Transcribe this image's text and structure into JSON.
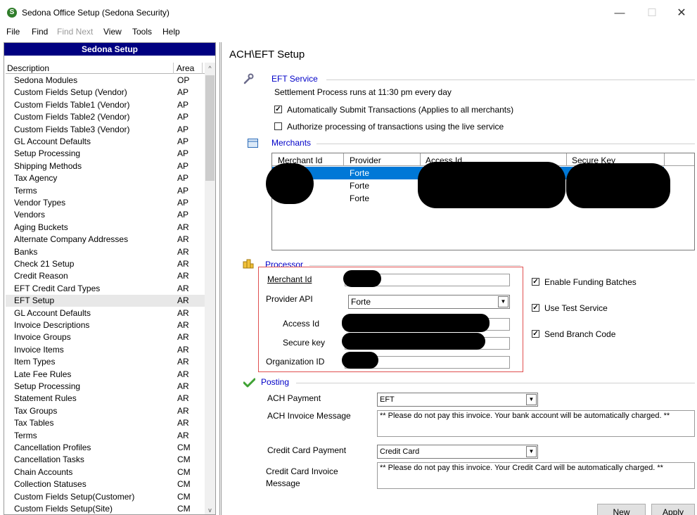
{
  "window": {
    "title": "Sedona Office Setup (Sedona Security)",
    "app_icon_letter": "S",
    "minimize_glyph": "—",
    "maximize_glyph": "☐",
    "close_glyph": "✕"
  },
  "menu": [
    {
      "label": "File",
      "enabled": true
    },
    {
      "label": "Find",
      "enabled": true
    },
    {
      "label": "Find Next",
      "enabled": false
    },
    {
      "label": "View",
      "enabled": true
    },
    {
      "label": "Tools",
      "enabled": true
    },
    {
      "label": "Help",
      "enabled": true
    }
  ],
  "left_panel": {
    "header": "Sedona Setup",
    "columns": {
      "description": "Description",
      "area": "Area"
    },
    "scroll_up": "^",
    "scroll_down": "v",
    "selected_index": 21,
    "items": [
      {
        "description": "Sedona Modules",
        "area": "OP"
      },
      {
        "description": "Custom Fields Setup (Vendor)",
        "area": "AP"
      },
      {
        "description": "Custom Fields Table1 (Vendor)",
        "area": "AP"
      },
      {
        "description": "Custom Fields Table2 (Vendor)",
        "area": "AP"
      },
      {
        "description": "Custom Fields Table3 (Vendor)",
        "area": "AP"
      },
      {
        "description": "GL Account Defaults",
        "area": "AP"
      },
      {
        "description": "Setup Processing",
        "area": "AP"
      },
      {
        "description": "Shipping Methods",
        "area": "AP"
      },
      {
        "description": "Tax Agency",
        "area": "AP"
      },
      {
        "description": "Terms",
        "area": "AP"
      },
      {
        "description": "Vendor Types",
        "area": "AP"
      },
      {
        "description": "Vendors",
        "area": "AP"
      },
      {
        "description": "Aging Buckets",
        "area": "AR"
      },
      {
        "description": "Alternate Company Addresses",
        "area": "AR"
      },
      {
        "description": "Banks",
        "area": "AR"
      },
      {
        "description": "Check 21 Setup",
        "area": "AR"
      },
      {
        "description": "Credit Reason",
        "area": "AR"
      },
      {
        "description": "EFT Credit Card Types",
        "area": "AR"
      },
      {
        "description": "EFT Setup",
        "area": "AR"
      },
      {
        "description": "GL Account Defaults",
        "area": "AR"
      },
      {
        "description": "Invoice Descriptions",
        "area": "AR"
      },
      {
        "description": "Invoice Groups",
        "area": "AR"
      },
      {
        "description": "Invoice Items",
        "area": "AR"
      },
      {
        "description": "Item Types",
        "area": "AR"
      },
      {
        "description": "Late Fee Rules",
        "area": "AR"
      },
      {
        "description": "Setup Processing",
        "area": "AR"
      },
      {
        "description": "Statement Rules",
        "area": "AR"
      },
      {
        "description": "Tax Groups",
        "area": "AR"
      },
      {
        "description": "Tax Tables",
        "area": "AR"
      },
      {
        "description": "Terms",
        "area": "AR"
      },
      {
        "description": "Cancellation Profiles",
        "area": "CM"
      },
      {
        "description": "Cancellation Tasks",
        "area": "CM"
      },
      {
        "description": "Chain Accounts",
        "area": "CM"
      },
      {
        "description": "Collection Statuses",
        "area": "CM"
      },
      {
        "description": "Custom Fields Setup(Customer)",
        "area": "CM"
      },
      {
        "description": "Custom Fields Setup(Site)",
        "area": "CM"
      }
    ]
  },
  "page": {
    "title": "ACH\\EFT Setup",
    "eft_service": {
      "label": "EFT Service",
      "settlement_text": "Settlement Process runs at 11:30 pm every day",
      "auto_submit": {
        "label": "Automatically Submit Transactions (Applies to all merchants)",
        "checked": true
      },
      "live_service": {
        "label": "Authorize processing of transactions using the live service",
        "checked": false
      }
    },
    "merchants": {
      "label": "Merchants",
      "columns": [
        "Merchant Id",
        "Provider",
        "Access Id",
        "Secure Key"
      ],
      "rows": [
        {
          "provider": "Forte",
          "selected": true,
          "secure_key_suffix": ""
        },
        {
          "provider": "Forte",
          "selected": false,
          "secure_key_suffix": ""
        },
        {
          "provider": "Forte",
          "selected": false,
          "secure_key_suffix": ".."
        }
      ]
    },
    "processor": {
      "label": "Processor",
      "merchant_id_label": "Merchant Id",
      "provider_api_label": "Provider API",
      "provider_api_value": "Forte",
      "access_id_label": "Access Id",
      "secure_key_label": "Secure key",
      "organization_id_label": "Organization ID",
      "enable_funding": {
        "label": "Enable Funding Batches",
        "checked": true
      },
      "use_test": {
        "label": "Use Test Service",
        "checked": true
      },
      "send_branch": {
        "label": "Send Branch Code",
        "checked": true
      }
    },
    "posting": {
      "label": "Posting",
      "ach_payment_label": "ACH Payment",
      "ach_payment_value": "EFT",
      "ach_invoice_label": "ACH Invoice Message",
      "ach_invoice_value": "** Please do not pay this invoice.  Your bank account will be automatically charged. **",
      "cc_payment_label": "Credit Card Payment",
      "cc_payment_value": "Credit Card",
      "cc_invoice_label_1": "Credit Card Invoice",
      "cc_invoice_label_2": "Message",
      "cc_invoice_value": "** Please do not pay this invoice.  Your Credit Card will be automatically charged. **"
    },
    "buttons": {
      "new": "New",
      "apply": "Apply"
    },
    "colors": {
      "header_bg": "#000080",
      "link_blue": "#0000c8",
      "selection": "#0078d7",
      "highlight_box": "#e05050"
    }
  }
}
